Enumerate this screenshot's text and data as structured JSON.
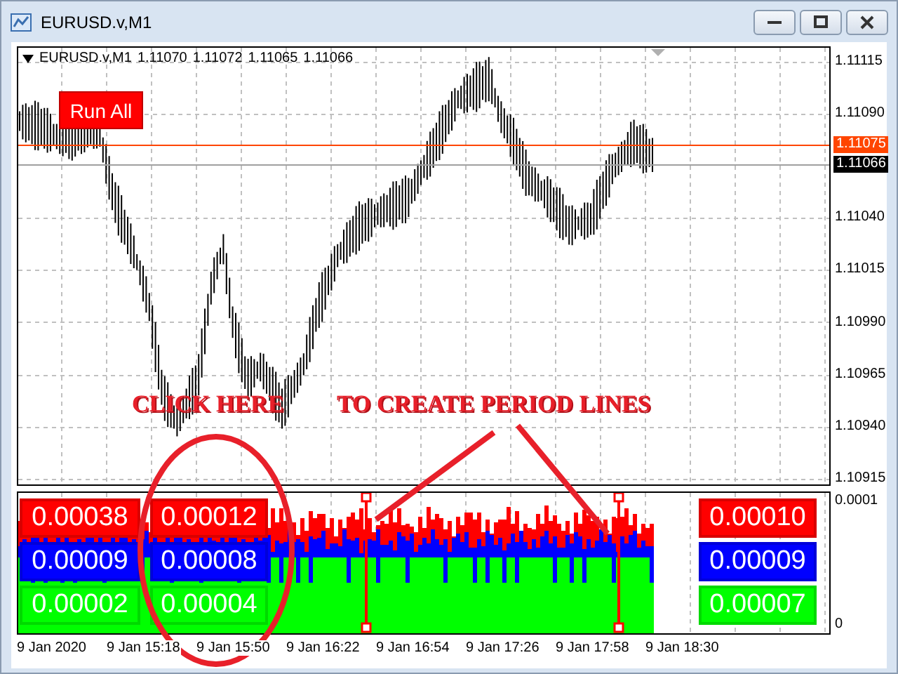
{
  "window": {
    "title": "EURUSD.v,M1"
  },
  "chart": {
    "symbol": "EURUSD.v,M1",
    "ohlc": [
      "1.11070",
      "1.11072",
      "1.11065",
      "1.11066"
    ],
    "price_ticks": [
      "1.11115",
      "1.11090",
      "1.11040",
      "1.11015",
      "1.10990",
      "1.10965",
      "1.10940",
      "1.10915"
    ],
    "price_lines": [
      {
        "text": "1.11075",
        "color": "#ff4500"
      },
      {
        "text": "1.11066",
        "color": "#000000"
      }
    ],
    "run_all_button": "Run All",
    "annotation": {
      "left": "CLICK HERE",
      "right": "TO CREATE PERIOD LINES"
    }
  },
  "indicator": {
    "axis": [
      "0.0001",
      "0"
    ],
    "columns": [
      [
        {
          "value": "0.00038",
          "color": "#ff0000"
        },
        {
          "value": "0.00009",
          "color": "#0000ff"
        },
        {
          "value": "0.00002",
          "color": "#00ff00"
        }
      ],
      [
        {
          "value": "0.00012",
          "color": "#ff0000"
        },
        {
          "value": "0.00008",
          "color": "#0000ff"
        },
        {
          "value": "0.00004",
          "color": "#00ff00"
        }
      ],
      [
        {
          "value": "0.00010",
          "color": "#ff0000"
        },
        {
          "value": "0.00009",
          "color": "#0000ff"
        },
        {
          "value": "0.00007",
          "color": "#00ff00"
        }
      ]
    ]
  },
  "time_labels": [
    "9 Jan 2020",
    "9 Jan 15:18",
    "9 Jan 15:50",
    "9 Jan 16:22",
    "9 Jan 16:54",
    "9 Jan 17:26",
    "9 Jan 17:58",
    "9 Jan 18:30"
  ]
}
